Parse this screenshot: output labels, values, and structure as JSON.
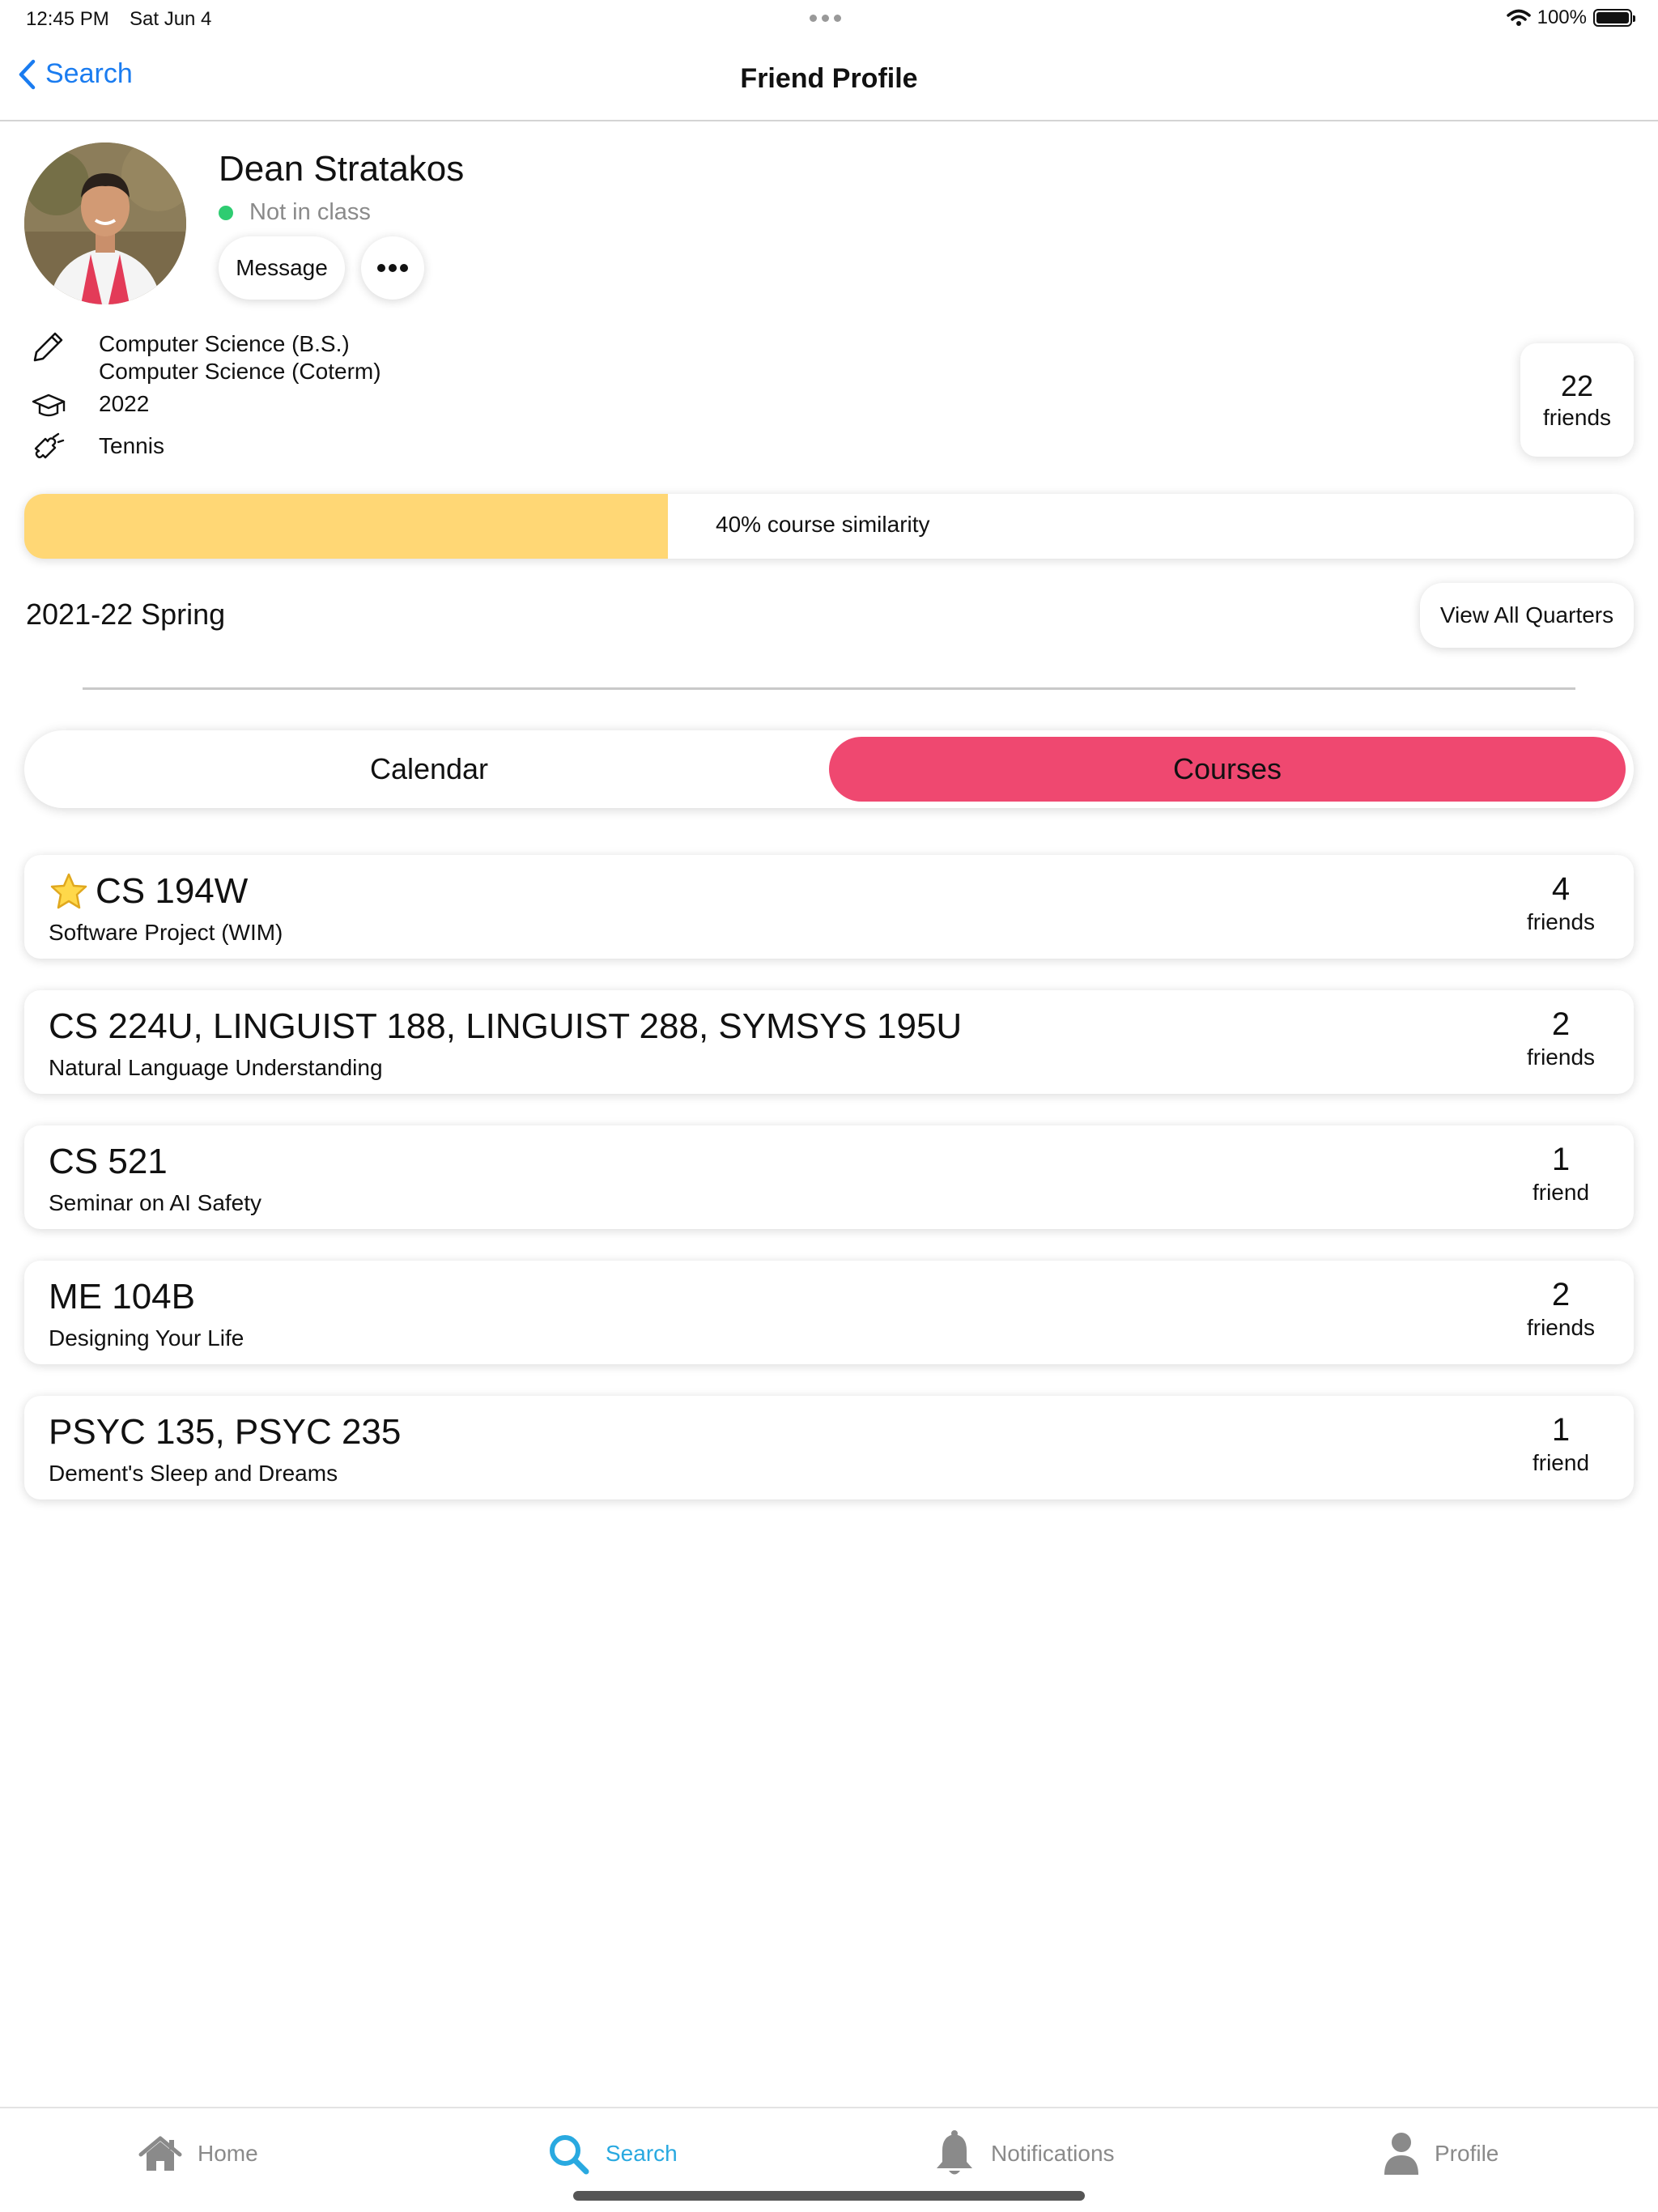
{
  "status_bar": {
    "time": "12:45 PM",
    "date": "Sat Jun 4",
    "battery": "100%"
  },
  "nav": {
    "back_label": "Search",
    "title": "Friend Profile"
  },
  "profile": {
    "name": "Dean Stratakos",
    "status": "Not in class",
    "message_label": "Message",
    "majors": [
      "Computer Science (B.S.)",
      "Computer Science (Coterm)"
    ],
    "class_year": "2022",
    "interest": "Tennis",
    "friends_count": "22",
    "friends_label": "friends"
  },
  "similarity": {
    "fraction": 0.4,
    "text": "40% course similarity"
  },
  "quarter": {
    "title": "2021-22 Spring",
    "view_all_label": "View All Quarters"
  },
  "segments": {
    "calendar": "Calendar",
    "courses": "Courses",
    "selected": "courses"
  },
  "courses": [
    {
      "code": "CS 194W",
      "name": "Software Project (WIM)",
      "friends": "4",
      "friends_label": "friends",
      "starred": true
    },
    {
      "code": "CS 224U, LINGUIST 188, LINGUIST 288, SYMSYS 195U",
      "name": "Natural Language Understanding",
      "friends": "2",
      "friends_label": "friends",
      "starred": false
    },
    {
      "code": "CS 521",
      "name": "Seminar on AI Safety",
      "friends": "1",
      "friends_label": "friend",
      "starred": false
    },
    {
      "code": "ME 104B",
      "name": "Designing Your Life",
      "friends": "2",
      "friends_label": "friends",
      "starred": false
    },
    {
      "code": "PSYC 135, PSYC 235",
      "name": "Dement's Sleep and Dreams",
      "friends": "1",
      "friends_label": "friend",
      "starred": false
    }
  ],
  "tabs": [
    {
      "label": "Home",
      "icon": "home-icon"
    },
    {
      "label": "Search",
      "icon": "search-icon"
    },
    {
      "label": "Notifications",
      "icon": "bell-icon"
    },
    {
      "label": "Profile",
      "icon": "person-icon"
    }
  ],
  "colors": {
    "accent": "#1a7cf0",
    "segment_selected": "#ef4870",
    "similarity_fill": "#ffd775",
    "tab_active": "#29a9e0",
    "online": "#2ecc71"
  }
}
